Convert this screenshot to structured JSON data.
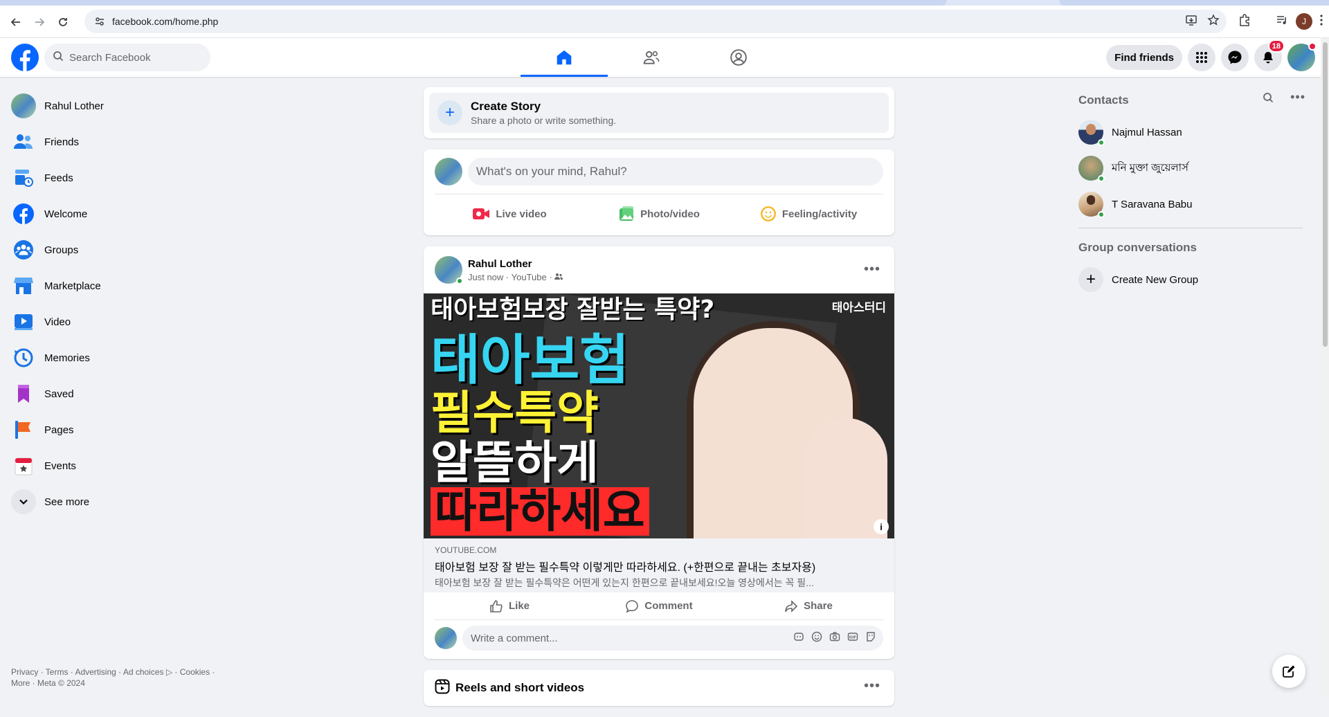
{
  "browser": {
    "url": "facebook.com/home.php",
    "account_initial": "J"
  },
  "header": {
    "search_placeholder": "Search Facebook",
    "find_friends": "Find friends",
    "notifications_count": "18"
  },
  "sidebar": {
    "items": [
      {
        "label": "Rahul Lother",
        "icon": "avatar"
      },
      {
        "label": "Friends",
        "icon": "friends-icon"
      },
      {
        "label": "Feeds",
        "icon": "feeds-icon"
      },
      {
        "label": "Welcome",
        "icon": "facebook-icon"
      },
      {
        "label": "Groups",
        "icon": "groups-icon"
      },
      {
        "label": "Marketplace",
        "icon": "marketplace-icon"
      },
      {
        "label": "Video",
        "icon": "video-icon"
      },
      {
        "label": "Memories",
        "icon": "memories-icon"
      },
      {
        "label": "Saved",
        "icon": "saved-icon"
      },
      {
        "label": "Pages",
        "icon": "pages-icon"
      },
      {
        "label": "Events",
        "icon": "events-icon"
      },
      {
        "label": "See more",
        "icon": "chevron-down-icon"
      }
    ],
    "footer_line1": "Privacy · Terms · Advertising · Ad choices ▷ · Cookies ·",
    "footer_line2": "More · Meta © 2024"
  },
  "story": {
    "title": "Create Story",
    "subtitle": "Share a photo or write something."
  },
  "composer": {
    "placeholder": "What's on your mind, Rahul?",
    "actions": [
      "Live video",
      "Photo/video",
      "Feeling/activity"
    ]
  },
  "post": {
    "author": "Rahul Lother",
    "meta": "Just now · YouTube ·",
    "thumbnail_lines": [
      "태아보험보장 잘받는 특약?",
      "태아보험",
      "필수특약",
      "알뜰하게",
      "따라하세요"
    ],
    "thumbnail_brand": "태아스터디",
    "link_domain": "YOUTUBE.COM",
    "link_title": "태아보험 보장 잘 받는 필수특약 이렇게만 따라하세요. (+한편으로 끝내는 초보자용)",
    "link_desc": "태아보험 보장 잘 받는 필수특약은 어떤게 있는지 한편으로 끝내보세요!오늘 영상에서는 꼭 필...",
    "actions": [
      "Like",
      "Comment",
      "Share"
    ],
    "comment_placeholder": "Write a comment..."
  },
  "reels": {
    "title": "Reels and short videos"
  },
  "contacts": {
    "title": "Contacts",
    "people": [
      {
        "name": "Najmul Hassan"
      },
      {
        "name": "মনি মুক্তা জুয়েলার্স"
      },
      {
        "name": "T Saravana Babu"
      }
    ],
    "group_title": "Group conversations",
    "create_group": "Create New Group"
  },
  "colors": {
    "accent": "#0866ff",
    "background": "#f0f2f5",
    "online": "#31a24c",
    "badge": "#e41e3f"
  }
}
